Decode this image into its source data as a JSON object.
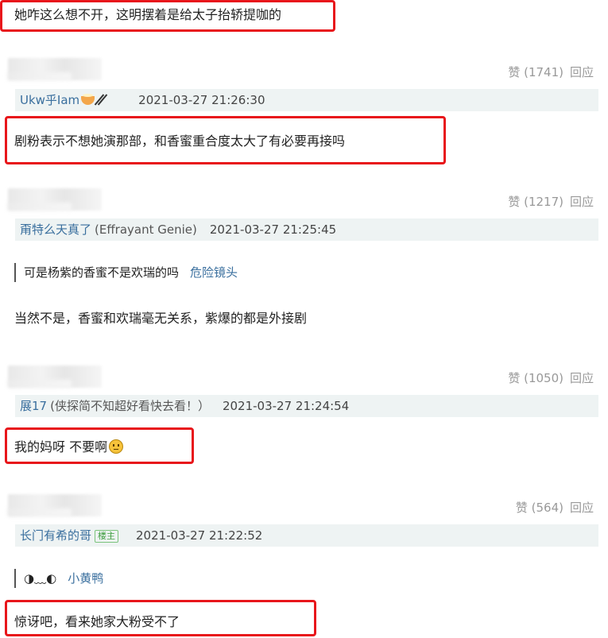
{
  "top_comment": {
    "text": "她咋这么想不开，这明摆着是给太子抬轿提咖的"
  },
  "posts": [
    {
      "likes": "赞 (1741)",
      "reply": "回应",
      "user": "Ukw乎Iam",
      "user_extra": "",
      "is_op": false,
      "time": "2021-03-27 21:26:30",
      "quote": null,
      "quote_source": null,
      "content": "剧粉表示不想她演那部，和香蜜重合度太大了有必要再接吗"
    },
    {
      "likes": "赞 (1217)",
      "reply": "回应",
      "user": "甭特么天真了",
      "user_extra": "(Effrayant Genie)",
      "is_op": false,
      "time": "2021-03-27 21:25:45",
      "quote": "可是杨紫的香蜜不是欢瑞的吗",
      "quote_source": "危险镜头",
      "content": "当然不是，香蜜和欢瑞毫无关系，紫爆的都是外接剧"
    },
    {
      "likes": "赞 (1050)",
      "reply": "回应",
      "user": "展17",
      "user_extra": "(侠探简不知超好看快去看！）",
      "is_op": false,
      "time": "2021-03-27 21:24:54",
      "quote": null,
      "quote_source": null,
      "content": "我的妈呀 不要啊"
    },
    {
      "likes": "赞 (564)",
      "reply": "回应",
      "user": "长门有希的哥",
      "user_extra": "",
      "is_op": true,
      "op_badge": "楼主",
      "time": "2021-03-27 21:22:52",
      "quote": "◑﹏◐",
      "quote_source": "小黄鸭",
      "content": "惊讶吧，看来她家大粉受不了"
    }
  ],
  "colors": {
    "highlight_box": "#e8161b",
    "username": "#3a6f9e",
    "meta_gray": "#999999"
  }
}
